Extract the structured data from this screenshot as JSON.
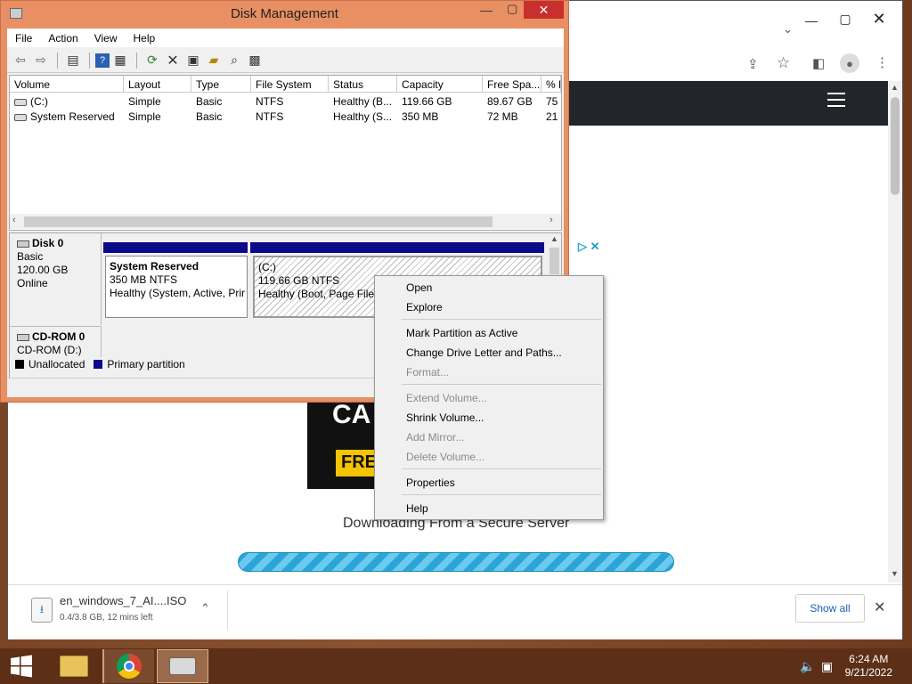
{
  "disk_management": {
    "title": "Disk Management",
    "menu": [
      "File",
      "Action",
      "View",
      "Help"
    ],
    "columns": [
      "Volume",
      "Layout",
      "Type",
      "File System",
      "Status",
      "Capacity",
      "Free Spa...",
      "% F"
    ],
    "volumes": [
      {
        "volume": "(C:)",
        "layout": "Simple",
        "type": "Basic",
        "fs": "NTFS",
        "status": "Healthy (B...",
        "capacity": "119.66 GB",
        "free": "89.67 GB",
        "pct": "75"
      },
      {
        "volume": "System Reserved",
        "layout": "Simple",
        "type": "Basic",
        "fs": "NTFS",
        "status": "Healthy (S...",
        "capacity": "350 MB",
        "free": "72 MB",
        "pct": "21"
      }
    ],
    "disk0": {
      "name": "Disk 0",
      "kind": "Basic",
      "size": "120.00 GB",
      "state": "Online"
    },
    "partitions": {
      "sys_reserved": {
        "name": "System Reserved",
        "size": "350 MB NTFS",
        "status": "Healthy (System, Active, Prir"
      },
      "c_drive": {
        "name": "(C:)",
        "size": "119.66 GB NTFS",
        "status": "Healthy (Boot, Page File,"
      }
    },
    "cdrom": {
      "name": "CD-ROM 0",
      "label": "CD-ROM (D:)"
    },
    "legend": {
      "unallocated": "Unallocated",
      "primary": "Primary partition"
    }
  },
  "context_menu": {
    "items": [
      {
        "label": "Open",
        "enabled": true
      },
      {
        "label": "Explore",
        "enabled": true
      },
      {
        "label": "Mark Partition as Active",
        "enabled": true
      },
      {
        "label": "Change Drive Letter and Paths...",
        "enabled": true
      },
      {
        "label": "Format...",
        "enabled": false
      },
      {
        "label": "Extend Volume...",
        "enabled": false
      },
      {
        "label": "Shrink Volume...",
        "enabled": true
      },
      {
        "label": "Add Mirror...",
        "enabled": false
      },
      {
        "label": "Delete Volume...",
        "enabled": false
      },
      {
        "label": "Properties",
        "enabled": true
      },
      {
        "label": "Help",
        "enabled": true
      }
    ]
  },
  "browser": {
    "downloading_text": "Downloading From a Secure Server",
    "ad": {
      "line1": "CA",
      "line2": "FREI"
    },
    "download": {
      "filename": "en_windows_7_AI....ISO",
      "progress_text": "0.4/3.8 GB, 12 mins left",
      "show_all": "Show all"
    }
  },
  "taskbar": {
    "time": "6:24 AM",
    "date": "9/21/2022"
  },
  "colors": {
    "dm_frame": "#e88f63",
    "close_red": "#c7302c",
    "primary_partition": "#0a0a8a",
    "taskbar": "#5c2f16"
  }
}
